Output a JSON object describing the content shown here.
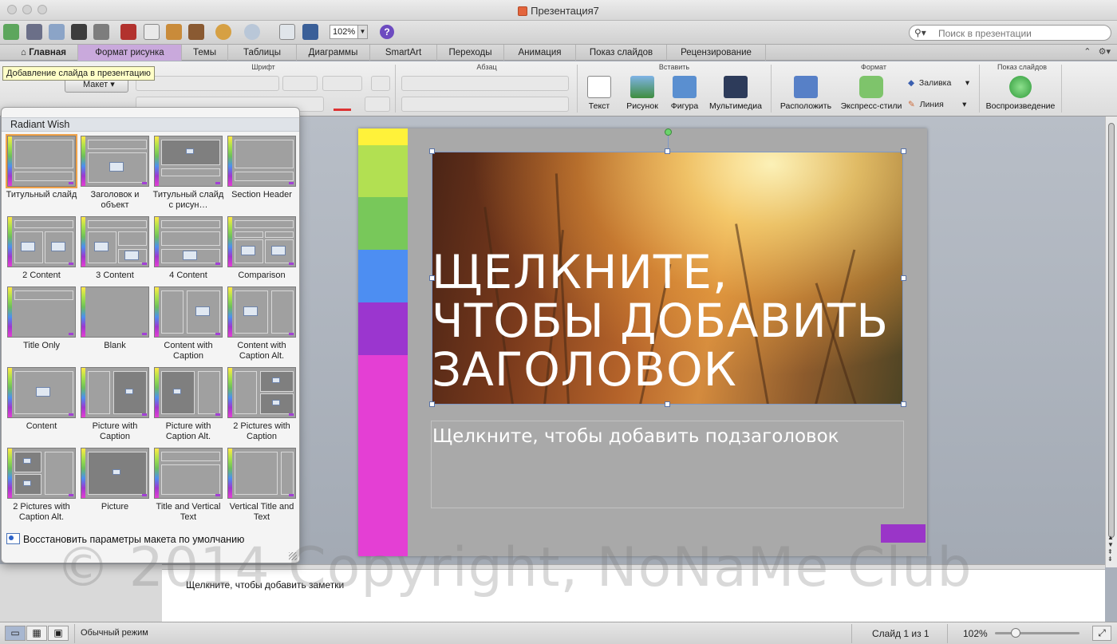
{
  "window": {
    "title": "Презентация7"
  },
  "toolbar": {
    "zoom_value": "102%",
    "search_placeholder": "Поиск в презентации"
  },
  "tabs": [
    {
      "label": "Главная"
    },
    {
      "label": "Формат рисунка"
    },
    {
      "label": "Темы"
    },
    {
      "label": "Таблицы"
    },
    {
      "label": "Диаграммы"
    },
    {
      "label": "SmartArt"
    },
    {
      "label": "Переходы"
    },
    {
      "label": "Анимация"
    },
    {
      "label": "Показ слайдов"
    },
    {
      "label": "Рецензирование"
    }
  ],
  "ribbon": {
    "groups": {
      "font": "Шрифт",
      "paragraph": "Абзац",
      "insert": "Вставить",
      "format": "Формат",
      "slideshow": "Показ слайдов"
    },
    "layout_button": "Макет",
    "insert_buttons": [
      "Текст",
      "Рисунок",
      "Фигура",
      "Мультимедиа"
    ],
    "format_buttons": [
      "Расположить",
      "Экспресс-стили"
    ],
    "fill_label": "Заливка",
    "line_label": "Линия",
    "play_label": "Воспроизведение"
  },
  "tooltip": "Добавление слайда в презентацию",
  "gallery": {
    "header": "Radiant Wish",
    "layouts": [
      {
        "label": "Титульный слайд"
      },
      {
        "label": "Заголовок и объект"
      },
      {
        "label": "Титульный слайд с рисун…"
      },
      {
        "label": "Section Header"
      },
      {
        "label": "2 Content"
      },
      {
        "label": "3 Content"
      },
      {
        "label": "4 Content"
      },
      {
        "label": "Comparison"
      },
      {
        "label": "Title Only"
      },
      {
        "label": "Blank"
      },
      {
        "label": "Content with Caption"
      },
      {
        "label": "Content with Caption Alt."
      },
      {
        "label": "Content"
      },
      {
        "label": "Picture with Caption"
      },
      {
        "label": "Picture with Caption Alt."
      },
      {
        "label": "2 Pictures with Caption"
      },
      {
        "label": "2 Pictures with Caption Alt."
      },
      {
        "label": "Picture"
      },
      {
        "label": "Title and Vertical Text"
      },
      {
        "label": "Vertical Title and Text"
      }
    ],
    "restore_label": "Восстановить параметры макета по умолчанию"
  },
  "slide": {
    "title_lines": [
      "ЩЕЛКНИТЕ,",
      "ЧТОБЫ ДОБАВИТЬ",
      "ЗАГОЛОВОК"
    ],
    "subtitle": "Щелкните, чтобы добавить подзаголовок",
    "stripe_colors": [
      "#fff23a",
      "#b2e052",
      "#78c85a",
      "#4d8ef2",
      "#9b36cf",
      "#e43fd4"
    ]
  },
  "notes": {
    "placeholder": "Щелкните, чтобы добавить заметки"
  },
  "statusbar": {
    "view_mode": "Обычный режим",
    "slide_counter": "Слайд 1 из 1",
    "zoom": "102%"
  },
  "watermark": "© 2014 Copyright, NoNaMe Club"
}
